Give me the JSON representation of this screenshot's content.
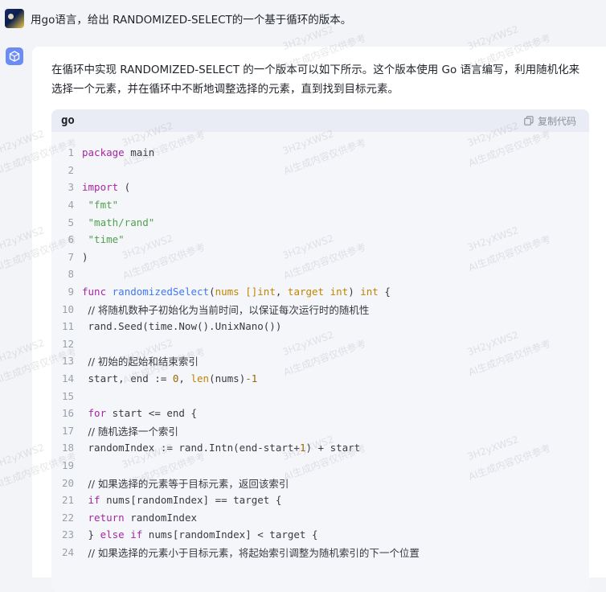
{
  "user_message": {
    "text": "用go语言，给出 RANDOMIZED-SELECT的一个基于循环的版本。"
  },
  "reply": {
    "intro": "在循环中实现 RANDOMIZED-SELECT 的一个版本可以如下所示。这个版本使用 Go 语言编写，利用随机化来选择一个元素，并在循环中不断地调整选择的元素，直到找到目标元素。",
    "code_block": {
      "language": "go",
      "copy_label": "复制代码",
      "lines": [
        {
          "n": "1",
          "tokens": [
            [
              "kw",
              "package"
            ],
            [
              "p",
              " main"
            ]
          ]
        },
        {
          "n": "2",
          "tokens": []
        },
        {
          "n": "3",
          "tokens": [
            [
              "kw",
              "import"
            ],
            [
              "p",
              " ("
            ]
          ]
        },
        {
          "n": "4",
          "tokens": [
            [
              "p",
              " "
            ],
            [
              "str",
              "\"fmt\""
            ]
          ]
        },
        {
          "n": "5",
          "tokens": [
            [
              "p",
              " "
            ],
            [
              "str",
              "\"math/rand\""
            ]
          ]
        },
        {
          "n": "6",
          "tokens": [
            [
              "p",
              " "
            ],
            [
              "str",
              "\"time\""
            ]
          ]
        },
        {
          "n": "7",
          "tokens": [
            [
              "p",
              ")"
            ]
          ]
        },
        {
          "n": "8",
          "tokens": []
        },
        {
          "n": "9",
          "tokens": [
            [
              "kw",
              "func"
            ],
            [
              "p",
              " "
            ],
            [
              "fn",
              "randomizedSelect"
            ],
            [
              "p",
              "("
            ],
            [
              "ty",
              "nums []int"
            ],
            [
              "p",
              ", "
            ],
            [
              "ty",
              "target int"
            ],
            [
              "p",
              ") "
            ],
            [
              "ty",
              "int"
            ],
            [
              "p",
              " {"
            ]
          ]
        },
        {
          "n": "10",
          "tokens": [
            [
              "p",
              " "
            ],
            [
              "cm",
              "// 将随机数种子初始化为当前时间，以保证每次运行时的随机性"
            ]
          ]
        },
        {
          "n": "11",
          "tokens": [
            [
              "p",
              " rand.Seed(time.Now().UnixNano())"
            ]
          ]
        },
        {
          "n": "12",
          "tokens": []
        },
        {
          "n": "13",
          "tokens": [
            [
              "p",
              " "
            ],
            [
              "cm",
              "// 初始的起始和结束索引"
            ]
          ]
        },
        {
          "n": "14",
          "tokens": [
            [
              "p",
              " start, end := "
            ],
            [
              "num",
              "0"
            ],
            [
              "p",
              ", "
            ],
            [
              "ty",
              "len"
            ],
            [
              "p",
              "(nums)"
            ],
            [
              "num",
              "-1"
            ]
          ]
        },
        {
          "n": "15",
          "tokens": []
        },
        {
          "n": "16",
          "tokens": [
            [
              "p",
              " "
            ],
            [
              "kw",
              "for"
            ],
            [
              "p",
              " start <= end {"
            ]
          ]
        },
        {
          "n": "17",
          "tokens": [
            [
              "p",
              " "
            ],
            [
              "cm",
              "// 随机选择一个索引"
            ]
          ]
        },
        {
          "n": "18",
          "tokens": [
            [
              "p",
              " randomIndex := rand.Intn(end-start+"
            ],
            [
              "num",
              "1"
            ],
            [
              "p",
              ") + start"
            ]
          ]
        },
        {
          "n": "19",
          "tokens": []
        },
        {
          "n": "20",
          "tokens": [
            [
              "p",
              " "
            ],
            [
              "cm",
              "// 如果选择的元素等于目标元素，返回该索引"
            ]
          ]
        },
        {
          "n": "21",
          "tokens": [
            [
              "p",
              " "
            ],
            [
              "kw",
              "if"
            ],
            [
              "p",
              " nums[randomIndex] == target {"
            ]
          ]
        },
        {
          "n": "22",
          "tokens": [
            [
              "p",
              " "
            ],
            [
              "kw",
              "return"
            ],
            [
              "p",
              " randomIndex"
            ]
          ]
        },
        {
          "n": "23",
          "tokens": [
            [
              "p",
              " } "
            ],
            [
              "kw",
              "else if"
            ],
            [
              "p",
              " nums[randomIndex] < target {"
            ]
          ]
        },
        {
          "n": "24",
          "tokens": [
            [
              "p",
              " "
            ],
            [
              "cm",
              "// 如果选择的元素小于目标元素，将起始索引调整为随机索引的下一个位置"
            ]
          ]
        }
      ]
    }
  },
  "watermark": {
    "line1": "3H2yXWS2",
    "line2": "AI生成内容仅供参考"
  },
  "colors": {
    "background": "#f3f4f7",
    "card": "#ffffff",
    "code_bg": "#f5f6fa",
    "code_header_bg": "#e9ecf5",
    "keyword": "#a626a4",
    "function": "#4078f2",
    "string": "#50a14f",
    "number": "#986801"
  }
}
